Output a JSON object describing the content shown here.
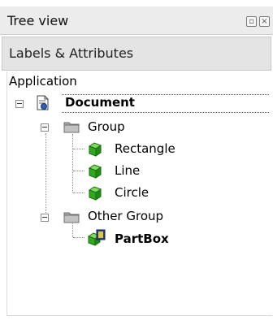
{
  "panel": {
    "title": "Tree view",
    "float_icon": "float-window-icon",
    "close_icon": "close-icon",
    "sub_header": "Labels & Attributes"
  },
  "tree": {
    "root": "Application",
    "document": "Document",
    "group": "Group",
    "rectangle": "Rectangle",
    "line": "Line",
    "circle": "Circle",
    "other_group": "Other Group",
    "partbox": "PartBox"
  },
  "colors": {
    "shape_green": "#2faa1f",
    "folder_gray": "#9a9a9a"
  }
}
